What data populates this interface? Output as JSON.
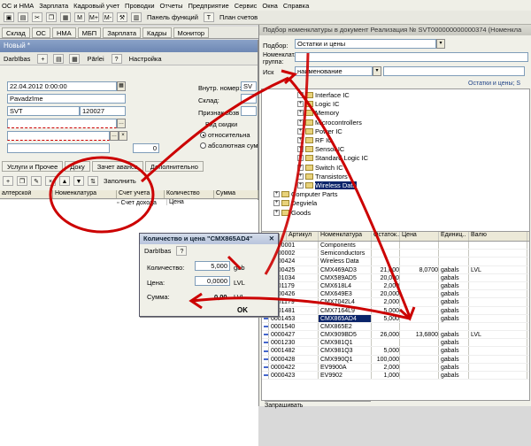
{
  "menubar": [
    "ОС и НМА",
    "Зарплата",
    "Кадровый учет",
    "Проводки",
    "Отчеты",
    "Предприятие",
    "Сервис",
    "Окна",
    "Справка"
  ],
  "toolbar1": {
    "panel_functions": "Панель функций",
    "plan_accounts": "План счетов"
  },
  "tabs": [
    "Склад",
    "ОС",
    "НМА",
    "МБП",
    "Зарплата",
    "Кадры",
    "Монитор"
  ],
  "left": {
    "title": "Новый *",
    "toolbar": {
      "actions": "Darbības",
      "price": "Pārlei",
      "settings": "Настройка"
    },
    "date": "22.04.2012 0:00:00",
    "field_name": "Pavadzīme",
    "field_code": "SVT",
    "field_num": "120027",
    "num_zero": "0",
    "label_internal_no": "Внутр. номер:",
    "val_internal_no": "SV",
    "label_warehouse": "Склад:",
    "label_recognition": "Признак возв",
    "group_discounts": "Вид скидки",
    "radio_relative": "относительна",
    "radio_absolute": "абсолютная сумм",
    "doc_tabs": [
      "Услуги и Прочее",
      "Доку",
      "Зачет аванса",
      "Дополнительно"
    ],
    "fill_button": "Заполнить",
    "grid_cols": [
      "алтерской",
      "Номенклатура",
      "Счет учета",
      "Количество",
      "Сумма"
    ],
    "grid_sub": [
      "Цена"
    ],
    "grid_sub2": "Счет дохода"
  },
  "right": {
    "title": "Подбор номенклатуры в документ Реализация № SVT000000000000374 (Номенкла",
    "label_podbor": "Подбор:",
    "podbor_value": "Остатки и цены",
    "label_group": "Номенклат. группа:",
    "label_search": "Иск",
    "search_field": "наименование",
    "link_right": "Остатки и цены; S",
    "tree": [
      {
        "label": "Interface IC",
        "indent": 4
      },
      {
        "label": "Logic IC",
        "indent": 4
      },
      {
        "label": "Memory",
        "indent": 4
      },
      {
        "label": "Microcontrollers",
        "indent": 4
      },
      {
        "label": "Power IC",
        "indent": 4
      },
      {
        "label": "RF IC",
        "indent": 4
      },
      {
        "label": "Sensor IC",
        "indent": 4
      },
      {
        "label": "Standard Logic IC",
        "indent": 4
      },
      {
        "label": "Switch IC",
        "indent": 4
      },
      {
        "label": "Transistors",
        "indent": 4
      },
      {
        "label": "Wireless Data",
        "indent": 4,
        "selected": true
      },
      {
        "label": "Computer Parts",
        "indent": 1
      },
      {
        "label": "Degvielа",
        "indent": 1
      },
      {
        "label": "Goods",
        "indent": 1
      }
    ],
    "table_cols": [
      "",
      "Артикул",
      "Номенклатура",
      "Остаток..",
      "Цена",
      "Единиц..",
      "Валю"
    ],
    "rows": [
      {
        "code": "0000001",
        "name": "Components",
        "rest": "",
        "price": "",
        "unit": "",
        "cur": ""
      },
      {
        "code": "0000002",
        "name": "Semiconductors",
        "rest": "",
        "price": "",
        "unit": "",
        "cur": ""
      },
      {
        "code": "0000424",
        "name": "Wireless Data",
        "rest": "",
        "price": "",
        "unit": "",
        "cur": ""
      },
      {
        "code": "0000425",
        "name": "CMX469AD3",
        "rest": "21,000",
        "price": "8,0700",
        "unit": "gabals",
        "cur": "LVL"
      },
      {
        "code": "0001034",
        "name": "CMX589AD5",
        "rest": "20,000",
        "price": "",
        "unit": "gabals",
        "cur": ""
      },
      {
        "code": "0001179",
        "name": "CMX618L4",
        "rest": "2,000",
        "price": "",
        "unit": "gabals",
        "cur": ""
      },
      {
        "code": "0000426",
        "name": "CMX649E3",
        "rest": "20,000",
        "price": "",
        "unit": "gabals",
        "cur": ""
      },
      {
        "code": "0001179",
        "name": "CMX7042L4",
        "rest": "2,000",
        "price": "",
        "unit": "gabals",
        "cur": ""
      },
      {
        "code": "0001481",
        "name": "CMX7164L9",
        "rest": "5,000",
        "price": "",
        "unit": "gabals",
        "cur": ""
      },
      {
        "code": "0001453",
        "name": "CMX865AD4",
        "rest": "5,000",
        "price": "",
        "unit": "gabals",
        "cur": "",
        "highlight": true
      },
      {
        "code": "0001540",
        "name": "CMX865E2",
        "rest": "",
        "price": "",
        "unit": "",
        "cur": ""
      },
      {
        "code": "0000427",
        "name": "CMX909BD5",
        "rest": "26,000",
        "price": "13,6800",
        "unit": "gabals",
        "cur": "LVL"
      },
      {
        "code": "0001230",
        "name": "CMX981Q1",
        "rest": "",
        "price": "",
        "unit": "gabals",
        "cur": ""
      },
      {
        "code": "0001482",
        "name": "CMX981Q3",
        "rest": "5,000",
        "price": "",
        "unit": "gabals",
        "cur": ""
      },
      {
        "code": "0000428",
        "name": "CMX990Q1",
        "rest": "100,000",
        "price": "",
        "unit": "gabals",
        "cur": ""
      },
      {
        "code": "0000422",
        "name": "EV9900A",
        "rest": "2,000",
        "price": "",
        "unit": "gabals",
        "cur": ""
      },
      {
        "code": "0000423",
        "name": "EV9902",
        "rest": "1,000",
        "price": "",
        "unit": "gabals",
        "cur": ""
      }
    ],
    "footer_label": "Запрашивать"
  },
  "dialog": {
    "title": "Количество и цена \"CMX865AD4\"",
    "actions": "Darbības",
    "help": "?",
    "label_qty": "Количество:",
    "qty": "5,000",
    "qty_unit": "gab",
    "label_price": "Цена:",
    "price": "0,0000",
    "price_unit": "LVL",
    "label_sum": "Сумма:",
    "sum": "0,00",
    "sum_unit": "LVL",
    "ok": "OK"
  },
  "colors": {
    "annotation": "#cc0000",
    "selection": "#0a246a",
    "title_blue": "#6e88b4"
  }
}
